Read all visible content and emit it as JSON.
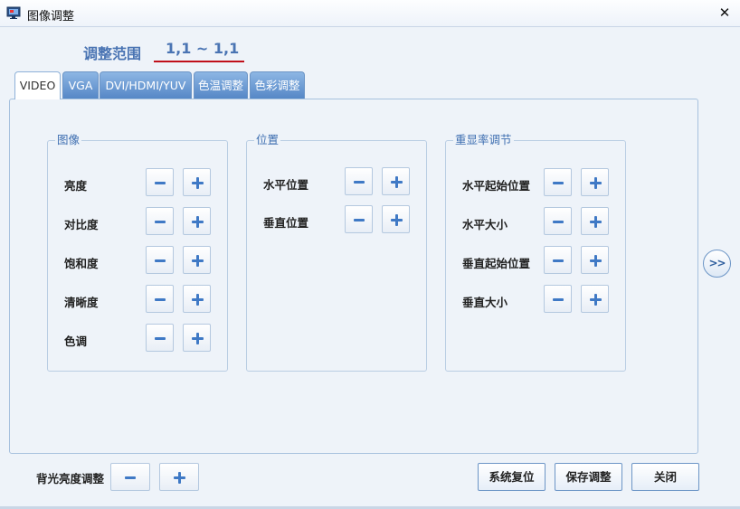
{
  "window": {
    "title": "图像调整",
    "close_symbol": "✕",
    "app_icon": "monitor-icon"
  },
  "range": {
    "label": "调整范围",
    "value": "1,1 ~ 1,1",
    "underline_color": "#c0101a"
  },
  "tabs": [
    {
      "label": "VIDEO",
      "active": true
    },
    {
      "label": "VGA",
      "active": false
    },
    {
      "label": "DVI/HDMI/YUV",
      "active": false
    },
    {
      "label": "色温调整",
      "active": false
    },
    {
      "label": "色彩调整",
      "active": false
    }
  ],
  "groups": {
    "image": {
      "title": "图像",
      "rows": [
        {
          "label": "亮度"
        },
        {
          "label": "对比度"
        },
        {
          "label": "饱和度"
        },
        {
          "label": "清晰度"
        },
        {
          "label": "色调"
        }
      ]
    },
    "position": {
      "title": "位置",
      "rows": [
        {
          "label": "水平位置"
        },
        {
          "label": "垂直位置"
        }
      ]
    },
    "refresh": {
      "title": "重显率调节",
      "rows": [
        {
          "label": "水平起始位置"
        },
        {
          "label": "水平大小"
        },
        {
          "label": "垂直起始位置"
        },
        {
          "label": "垂直大小"
        }
      ]
    }
  },
  "controls": {
    "minus_icon": "minus-icon",
    "plus_icon": "plus-icon"
  },
  "next_button": {
    "label": ">>"
  },
  "backlight": {
    "label": "背光亮度调整"
  },
  "actions": {
    "reset": "系统复位",
    "save": "保存调整",
    "close": "关闭"
  },
  "colors": {
    "accent": "#4a74b3",
    "tab_bg": "#5587c6",
    "icon_blue": "#3f79c5",
    "panel_bg": "#eef3f9"
  }
}
